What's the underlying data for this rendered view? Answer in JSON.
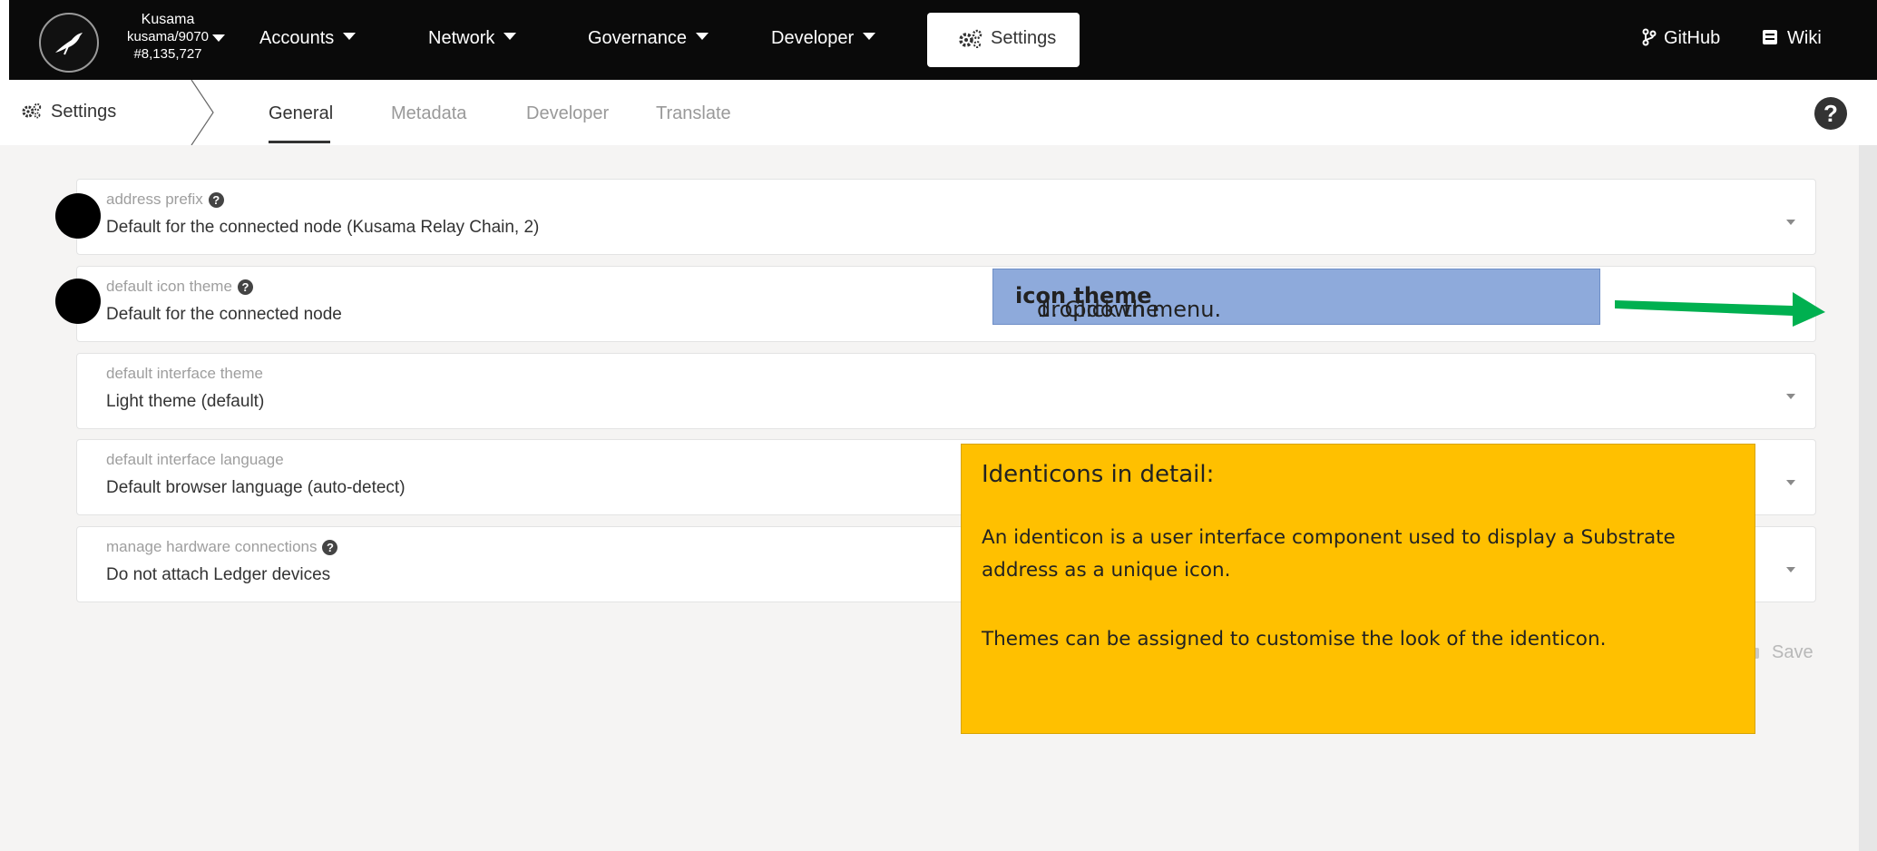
{
  "topbar": {
    "chain_name": "Kusama",
    "chain_node": "kusama/9070",
    "block_number": "#8,135,727",
    "nav": [
      {
        "label": "Accounts"
      },
      {
        "label": "Network"
      },
      {
        "label": "Governance"
      },
      {
        "label": "Developer"
      }
    ],
    "settings_label": "Settings",
    "github_label": "GitHub",
    "wiki_label": "Wiki"
  },
  "tabs": {
    "breadcrumb": "Settings",
    "items": [
      {
        "label": "General",
        "active": true
      },
      {
        "label": "Metadata",
        "active": false
      },
      {
        "label": "Developer",
        "active": false
      },
      {
        "label": "Translate",
        "active": false
      }
    ],
    "help_glyph": "?"
  },
  "settings": [
    {
      "label": "address prefix",
      "value": "Default for the connected node (Kusama Relay Chain, 2)",
      "has_help": true
    },
    {
      "label": "default icon theme",
      "value": "Default for the connected node",
      "has_help": true
    },
    {
      "label": "default interface theme",
      "value": "Light theme (default)",
      "has_help": false
    },
    {
      "label": "default interface language",
      "value": "Default browser language (auto-detect)",
      "has_help": false
    },
    {
      "label": "manage hardware connections",
      "value": "Do not attach Ledger devices",
      "has_help": true
    }
  ],
  "save_label": "Save",
  "annotations": {
    "step": {
      "prefix": "1. Click the ",
      "bold": "icon theme",
      "suffix": " dropdown menu."
    },
    "info": {
      "title": "Identicons in detail:",
      "paragraph1": "An identicon is a user interface component used to display a Substrate address as a unique icon.",
      "paragraph2": "Themes can be assigned to customise the look of the identicon."
    }
  },
  "colors": {
    "navbar": "#0a0a0a",
    "content_bg": "#f5f4f3",
    "callout_blue": "#8eaadb",
    "callout_yellow": "#ffc000",
    "arrow_green": "#00b050"
  }
}
